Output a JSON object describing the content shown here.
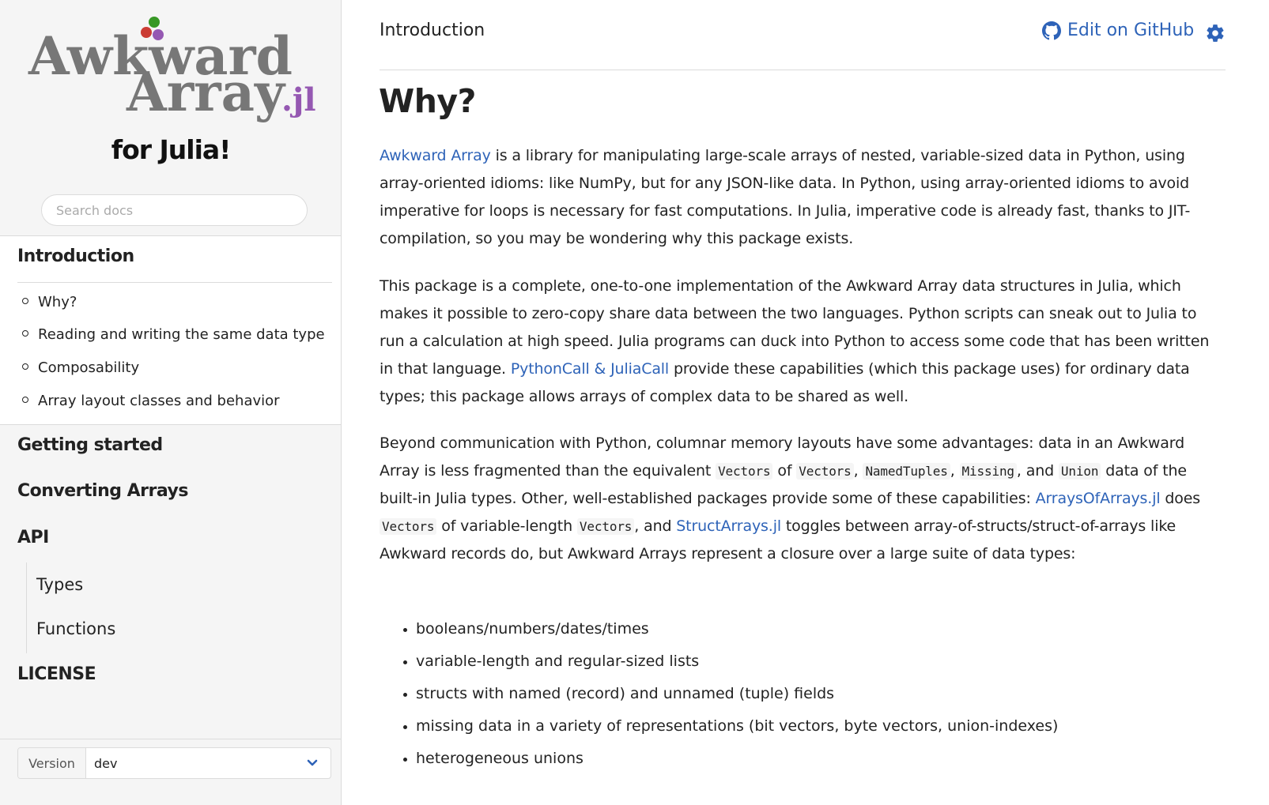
{
  "sidebar": {
    "logo": {
      "line1": "Awkward",
      "line2": "Array",
      "suffix": ".jl",
      "colors": {
        "text": "#777777",
        "suffix": "#9558b2",
        "dot_red": "#cb3c33",
        "dot_green": "#389826",
        "dot_purple": "#9558b2"
      }
    },
    "site_title": "for Julia!",
    "search": {
      "placeholder": "Search docs",
      "value": ""
    },
    "nav": {
      "introduction": {
        "label": "Introduction",
        "sections": [
          "Why?",
          "Reading and writing the same data type",
          "Composability",
          "Array layout classes and behavior"
        ]
      },
      "getting_started": "Getting started",
      "converting_arrays": "Converting Arrays",
      "api": {
        "label": "API",
        "children": [
          "Types",
          "Functions"
        ]
      },
      "license": "LICENSE"
    },
    "version": {
      "label": "Version",
      "value": "dev",
      "icon": "chevron-down-icon"
    }
  },
  "topbar": {
    "breadcrumb": "Introduction",
    "edit_label": "Edit on GitHub",
    "edit_icon": "github-icon",
    "settings_icon": "gear-icon"
  },
  "content": {
    "heading": "Why?",
    "p1": {
      "link": "Awkward Array",
      "text": " is a library for manipulating large-scale arrays of nested, variable-sized data in Python, using array-oriented idioms: like NumPy, but for any JSON-like data. In Python, using array-oriented idioms to avoid imperative for loops is necessary for fast computations. In Julia, imperative code is already fast, thanks to JIT-compilation, so you may be wondering why this package exists."
    },
    "p2": {
      "text1": "This package is a complete, one-to-one implementation of the Awkward Array data structures in Julia, which makes it possible to zero-copy share data between the two languages. Python scripts can sneak out to Julia to run a calculation at high speed. Julia programs can duck into Python to access some code that has been written in that language. ",
      "link": "PythonCall & JuliaCall",
      "text2": " provide these capabilities (which this package uses) for ordinary data types; this package allows arrays of complex data to be shared as well."
    },
    "p3": {
      "t1": "Beyond communication with Python, columnar memory layouts have some advantages: data in an Awkward Array is less fragmented than the equivalent ",
      "c1": "Vectors",
      "t2": " of ",
      "c2": "Vectors",
      "t3": ", ",
      "c3": "NamedTuples",
      "t4": ", ",
      "c4": "Missing",
      "t5": ", and ",
      "c5": "Union",
      "t6": " data of the built-in Julia types. Other, well-established packages provide some of these capabilities: ",
      "l1": "ArraysOfArrays.jl",
      "t7": " does ",
      "c6": "Vectors",
      "t8": " of variable-length ",
      "c7": "Vectors",
      "t9": ", and ",
      "l2": "StructArrays.jl",
      "t10": " toggles between array-of-structs/struct-of-arrays like Awkward records do, but Awkward Arrays represent a closure over a large suite of data types:"
    },
    "types": [
      "booleans/numbers/dates/times",
      "variable-length and regular-sized lists",
      "structs with named (record) and unnamed (tuple) fields",
      "missing data in a variety of representations (bit vectors, byte vectors, union-indexes)",
      "heterogeneous unions"
    ]
  },
  "colors": {
    "link": "#2e63b8",
    "sidebar_bg": "#f5f5f5",
    "border": "#dbdbdb"
  }
}
